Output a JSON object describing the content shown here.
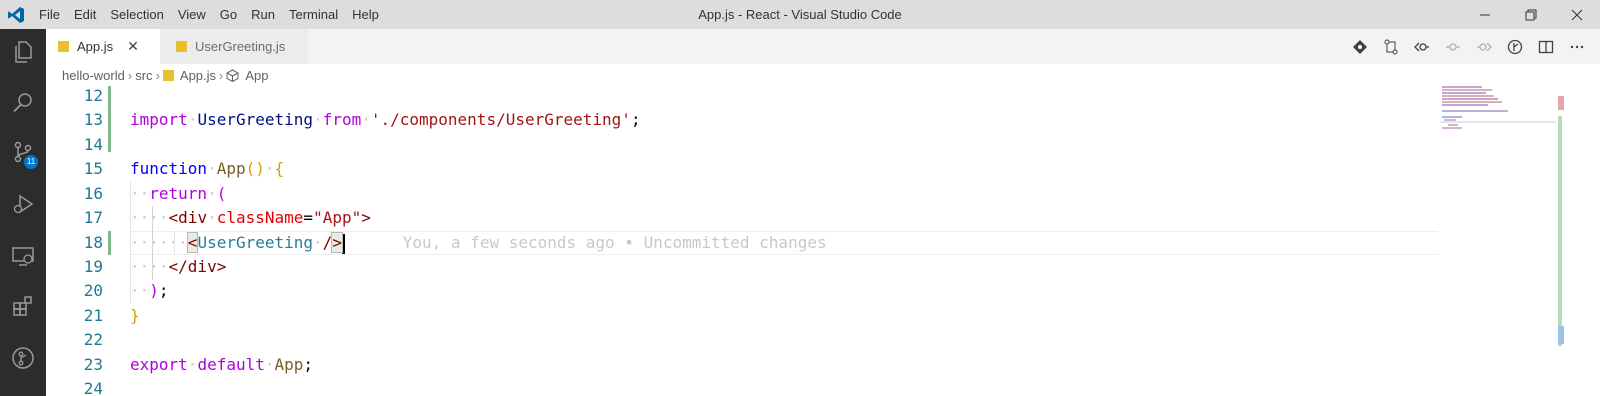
{
  "window": {
    "title": "App.js - React - Visual Studio Code",
    "menu": [
      "File",
      "Edit",
      "Selection",
      "View",
      "Go",
      "Run",
      "Terminal",
      "Help"
    ]
  },
  "activity_bar": {
    "items": [
      "explorer-icon",
      "search-icon",
      "source-control-icon",
      "run-debug-icon",
      "remote-explorer-icon",
      "extensions-icon",
      "gitlens-icon"
    ],
    "source_control_badge": "11"
  },
  "tabs": [
    {
      "label": "App.js",
      "active": true,
      "icon": "js-file-icon"
    },
    {
      "label": "UserGreeting.js",
      "active": false,
      "icon": "js-file-icon"
    }
  ],
  "editor_actions": [
    "git-compare-icon",
    "open-changes-icon",
    "previous-revision-icon",
    "commit-icon",
    "next-revision-icon",
    "gitlens-history-icon",
    "split-editor-icon",
    "more-actions-icon"
  ],
  "breadcrumb": {
    "parts": [
      "hello-world",
      "src",
      "App.js",
      "App"
    ]
  },
  "editor": {
    "line_numbers": [
      "12",
      "13",
      "14",
      "15",
      "16",
      "17",
      "18",
      "19",
      "20",
      "21",
      "22",
      "23",
      "24"
    ],
    "lines": {
      "l13": {
        "import": "import",
        "name": "UserGreeting",
        "from": "from",
        "path": "'./components/UserGreeting'",
        "end": ";"
      },
      "l15": {
        "function": "function",
        "name": "App",
        "parens": "()",
        "brace": "{"
      },
      "l16": {
        "return": "return",
        "paren": "("
      },
      "l17": {
        "open": "<",
        "tag": "div",
        "attr": "className",
        "eq": "=",
        "value": "\"App\"",
        "close": ">"
      },
      "l18": {
        "open": "<",
        "tag": "UserGreeting",
        "slash": "/",
        "close": ">",
        "blame": "You, a few seconds ago • Uncommitted changes"
      },
      "l19": {
        "open": "</",
        "tag": "div",
        "close": ">"
      },
      "l20": {
        "paren": ")",
        "end": ";"
      },
      "l21": {
        "brace": "}"
      },
      "l23": {
        "export": "export",
        "default": "default",
        "name": "App",
        "end": ";"
      }
    }
  },
  "colors": {
    "activity_bar": "#2c2c2c",
    "title_bar": "#dddddd",
    "accent": "#007acc",
    "keyword": "#af00db",
    "string": "#a31515",
    "added_gutter": "#81b88b"
  }
}
